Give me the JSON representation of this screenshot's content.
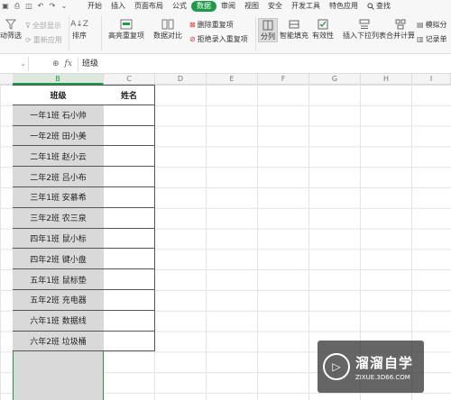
{
  "colors": {
    "accent": "#1e9b49",
    "selected_column_fill": "#d9d9d9"
  },
  "menu": {
    "items": [
      "开始",
      "插入",
      "页面布局",
      "公式",
      "数据",
      "审阅",
      "视图",
      "安全",
      "开发工具",
      "特色应用"
    ],
    "active": "数据",
    "search": "查找"
  },
  "ribbon": {
    "auto_filter": "动筛选",
    "show_all": "全部显示",
    "reapply": "重新应用",
    "sort": "排序",
    "highlight_dup": "高亮重复项",
    "data_compare": "数据对比",
    "remove_dup": "删除重复项",
    "reject_dup": "拒绝录入重复项",
    "split": "分列",
    "smart_fill": "智能填充",
    "validity": "有效性",
    "insert_dropdown": "插入下拉列表",
    "consolidate": "合并计算",
    "simulate": "模拟分",
    "record": "记录单"
  },
  "formula_bar": {
    "cell_ref": "",
    "content": "班级"
  },
  "columns": [
    "B",
    "C",
    "D",
    "E",
    "F",
    "G",
    "H",
    "I"
  ],
  "table": {
    "headers": [
      "班级",
      "姓名"
    ],
    "rows": [
      "一年1班 石小帅",
      "一年2班 田小美",
      "二年1班 赵小云",
      "二年2班 吕小布",
      "三年1班 安慕希",
      "三年2班 农三泉",
      "四年1班 鼠小标",
      "四年2班 键小盘",
      "五年1班 鼠标垫",
      "五年2班 充电器",
      "六年1班 数据线",
      "六年2班 垃圾桶"
    ]
  },
  "watermark": {
    "title": "溜溜自学",
    "url": "ZIXUE.3D66.COM"
  }
}
